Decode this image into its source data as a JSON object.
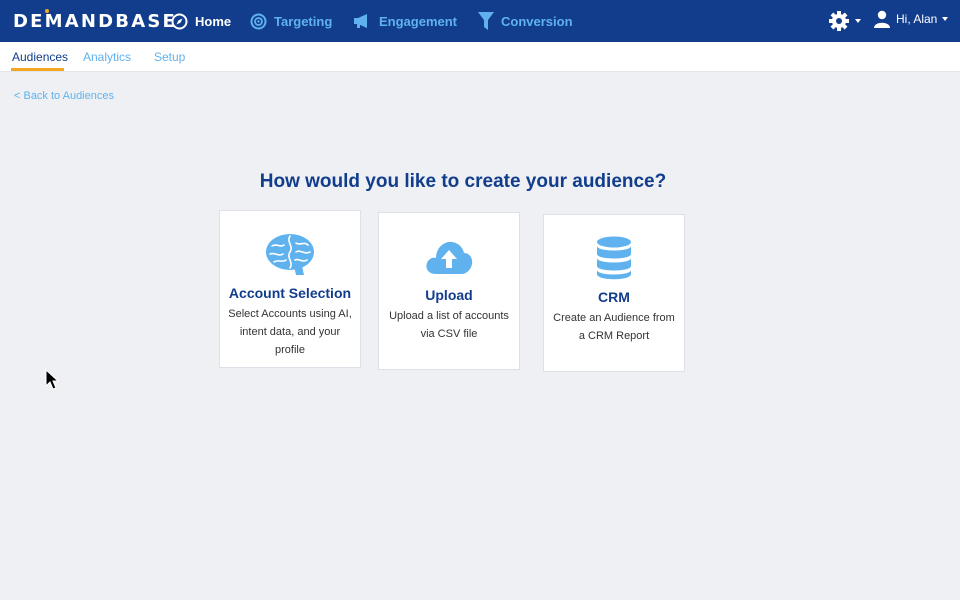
{
  "header": {
    "logo_text": "DEMANDBASE",
    "nav": [
      {
        "label": "Home",
        "icon": "compass-icon",
        "active": true
      },
      {
        "label": "Targeting",
        "icon": "target-icon",
        "active": false
      },
      {
        "label": "Engagement",
        "icon": "megaphone-icon",
        "active": false
      },
      {
        "label": "Conversion",
        "icon": "funnel-icon",
        "active": false
      }
    ],
    "settings_icon": "gear-icon",
    "user_greeting": "Hi, Alan"
  },
  "subnav": {
    "tabs": [
      {
        "label": "Audiences",
        "active": true
      },
      {
        "label": "Analytics",
        "active": false
      },
      {
        "label": "Setup",
        "active": false
      }
    ]
  },
  "back_link": "< Back to Audiences",
  "main": {
    "heading": "How would you like to create your audience?",
    "cards": [
      {
        "title": "Account Selection",
        "description": "Select Accounts using AI, intent data, and your profile",
        "icon": "brain-icon"
      },
      {
        "title": "Upload",
        "description": "Upload a list of accounts via CSV file",
        "icon": "cloud-upload-icon"
      },
      {
        "title": "CRM",
        "description": "Create an Audience from a CRM Report",
        "icon": "database-icon"
      }
    ]
  },
  "colors": {
    "header_bg": "#123d8c",
    "accent_light": "#5fb2ee",
    "accent_orange": "#f5a623",
    "page_bg": "#eef0f4"
  }
}
